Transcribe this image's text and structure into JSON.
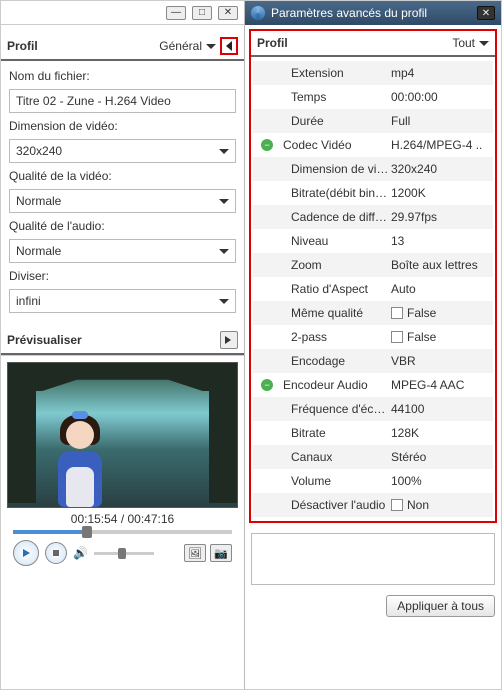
{
  "left": {
    "profile_title": "Profil",
    "general_label": "Général",
    "filename_label": "Nom du fichier:",
    "filename_value": "Titre 02 - Zune - H.264 Video",
    "dim_label": "Dimension de vidéo:",
    "dim_value": "320x240",
    "vquality_label": "Qualité de la vidéo:",
    "vquality_value": "Normale",
    "aquality_label": "Qualité de l'audio:",
    "aquality_value": "Normale",
    "split_label": "Diviser:",
    "split_value": "infini",
    "preview_title": "Prévisualiser",
    "time_current": "00:15:54",
    "time_total": "00:47:16"
  },
  "right": {
    "window_title": "Paramètres avancés du profil",
    "profile_title": "Profil",
    "all_label": "Tout",
    "rows": [
      {
        "label": "Extension",
        "value": "mp4",
        "indent": 1
      },
      {
        "label": "Temps",
        "value": "00:00:00",
        "indent": 1
      },
      {
        "label": "Durée",
        "value": "Full",
        "indent": 1
      },
      {
        "label": "Codec Vidéo",
        "value": "H.264/MPEG-4 ..",
        "indent": 0,
        "group": true
      },
      {
        "label": "Dimension de vid...",
        "value": "320x240",
        "indent": 1
      },
      {
        "label": "Bitrate(débit binai...",
        "value": "1200K",
        "indent": 1
      },
      {
        "label": "Cadence de diffu...",
        "value": "29.97fps",
        "indent": 1
      },
      {
        "label": "Niveau",
        "value": "13",
        "indent": 1
      },
      {
        "label": "Zoom",
        "value": "Boîte aux lettres",
        "indent": 1
      },
      {
        "label": "Ratio d'Aspect",
        "value": "Auto",
        "indent": 1
      },
      {
        "label": "Même qualité",
        "value": "False",
        "indent": 1,
        "checkbox": true
      },
      {
        "label": "2-pass",
        "value": "False",
        "indent": 1,
        "checkbox": true
      },
      {
        "label": "Encodage",
        "value": "VBR",
        "indent": 1
      },
      {
        "label": "Encodeur Audio",
        "value": "MPEG-4 AAC",
        "indent": 0,
        "group": true
      },
      {
        "label": "Fréquence d'écha...",
        "value": "44100",
        "indent": 1
      },
      {
        "label": "Bitrate",
        "value": "128K",
        "indent": 1
      },
      {
        "label": "Canaux",
        "value": "Stéréo",
        "indent": 1
      },
      {
        "label": "Volume",
        "value": "100%",
        "indent": 1
      },
      {
        "label": "Désactiver l'audio",
        "value": "Non",
        "indent": 1,
        "checkbox": true
      }
    ],
    "apply_label": "Appliquer à tous"
  }
}
